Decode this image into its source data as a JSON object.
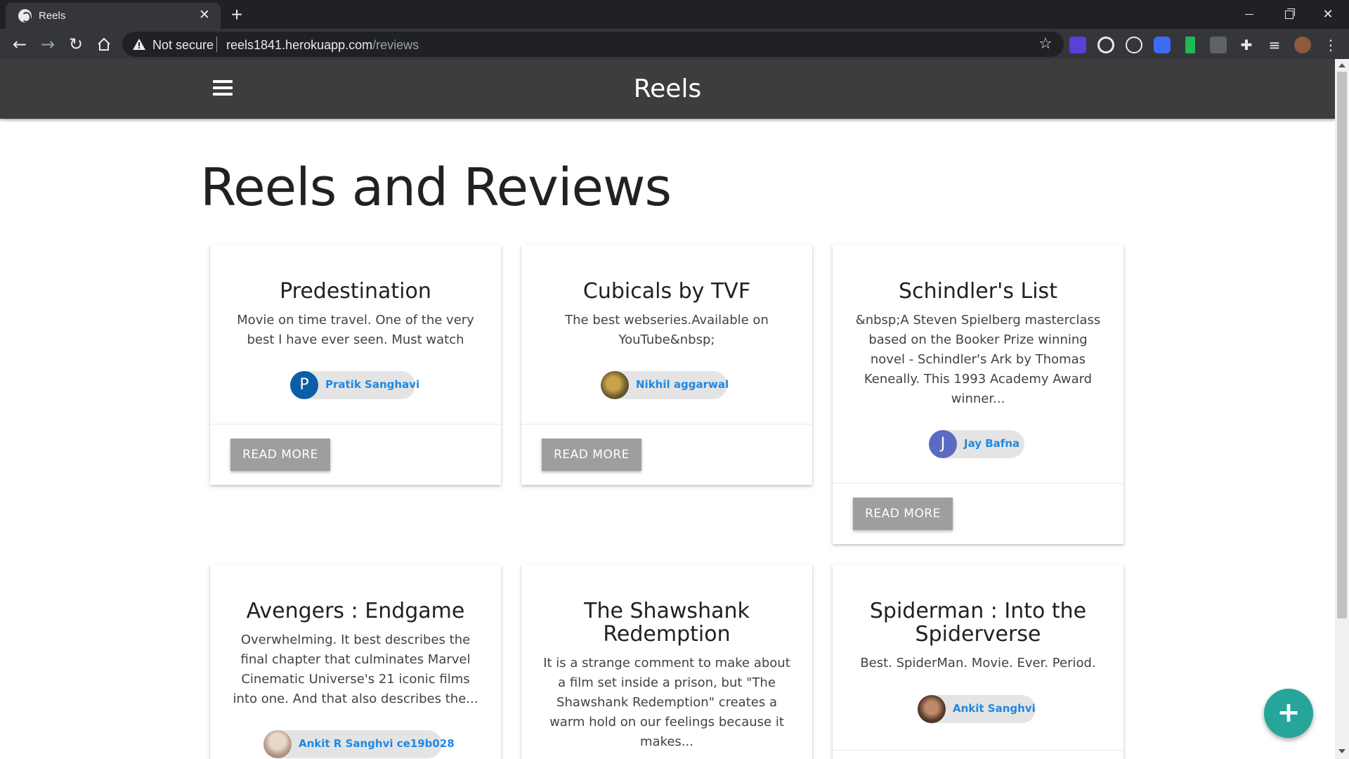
{
  "browser": {
    "tab_title": "Reels",
    "tab_close": "✕",
    "new_tab": "+",
    "security_label": "Not secure",
    "url_host": "reels1841.herokuapp.com",
    "url_path": "/reviews",
    "close_glyph": "✕"
  },
  "app": {
    "brand": "Reels",
    "page_title": "Reels and Reviews",
    "read_more_label": "READ MORE",
    "fab_label": "+"
  },
  "reviews": [
    {
      "title": "Predestination",
      "description": "Movie on time travel. One of the very best I have ever seen. Must watch",
      "author": "Pratik Sanghavi",
      "avatar_letter": "P",
      "avatar_color": "#0b5ea8"
    },
    {
      "title": "Cubicals by TVF",
      "description": "The best webseries.Available on YouTube&nbsp;",
      "author": "Nikhil aggarwal",
      "avatar_letter": "",
      "avatar_color": "#8a7a4a"
    },
    {
      "title": "Schindler's List",
      "description": "&nbsp;A Steven Spielberg masterclass based on the Booker Prize winning novel - Schindler's Ark by Thomas Keneally. This 1993 Academy Award winner...",
      "author": "Jay Bafna",
      "avatar_letter": "J",
      "avatar_color": "#5c6bc0"
    },
    {
      "title": "Avengers : Endgame",
      "description": "Overwhelming. It best describes the final chapter that culminates Marvel Cinematic Universe's 21 iconic films into one. And that also describes the...",
      "author": "Ankit R Sanghvi ce19b028",
      "avatar_letter": "",
      "avatar_color": "#b89a8a"
    },
    {
      "title": "The Shawshank Redemption",
      "description": "It is a strange comment to make about a film set inside a prison, but \"The Shawshank Redemption\" creates a warm hold on our feelings because it makes...",
      "author": "",
      "avatar_letter": "",
      "avatar_color": ""
    },
    {
      "title": "Spiderman : Into the Spiderverse",
      "description": "Best. SpiderMan. Movie. Ever. Period.",
      "author": "Ankit Sanghvi",
      "avatar_letter": "",
      "avatar_color": "#5a3a2a"
    }
  ]
}
